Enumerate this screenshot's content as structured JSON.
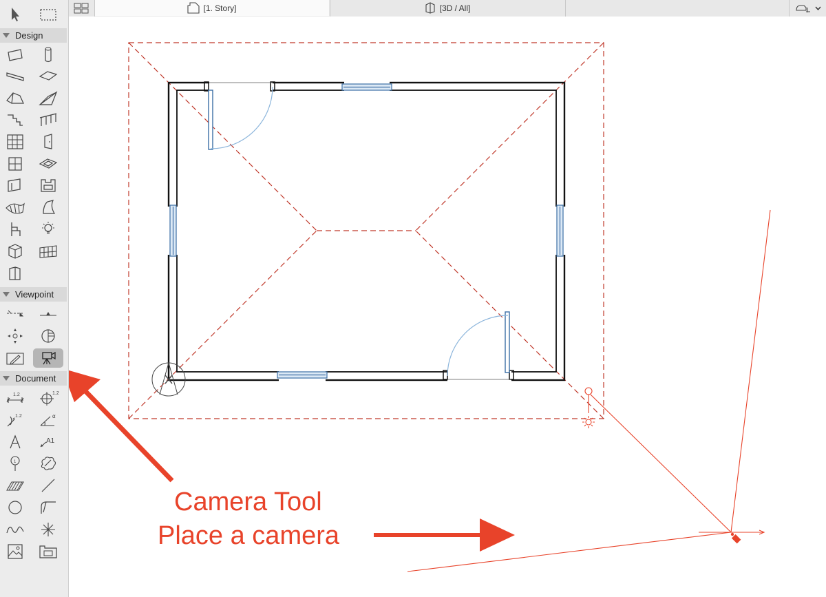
{
  "toolbox": {
    "sections": {
      "design": "Design",
      "viewpoint": "Viewpoint",
      "document": "Document"
    },
    "selected_tool": "camera-tool"
  },
  "tabs": [
    {
      "label": "[1. Story]",
      "selected": true
    },
    {
      "label": "[3D / All]",
      "selected": false
    }
  ],
  "annotation": {
    "line1": "Camera Tool",
    "line2": "Place a camera",
    "color": "#e8432a"
  },
  "colors": {
    "accent": "#e8432a",
    "wall": "#111111",
    "window": "#3b6ea5",
    "door_swing": "#8db6dc",
    "roof_outline": "#c0392b"
  }
}
